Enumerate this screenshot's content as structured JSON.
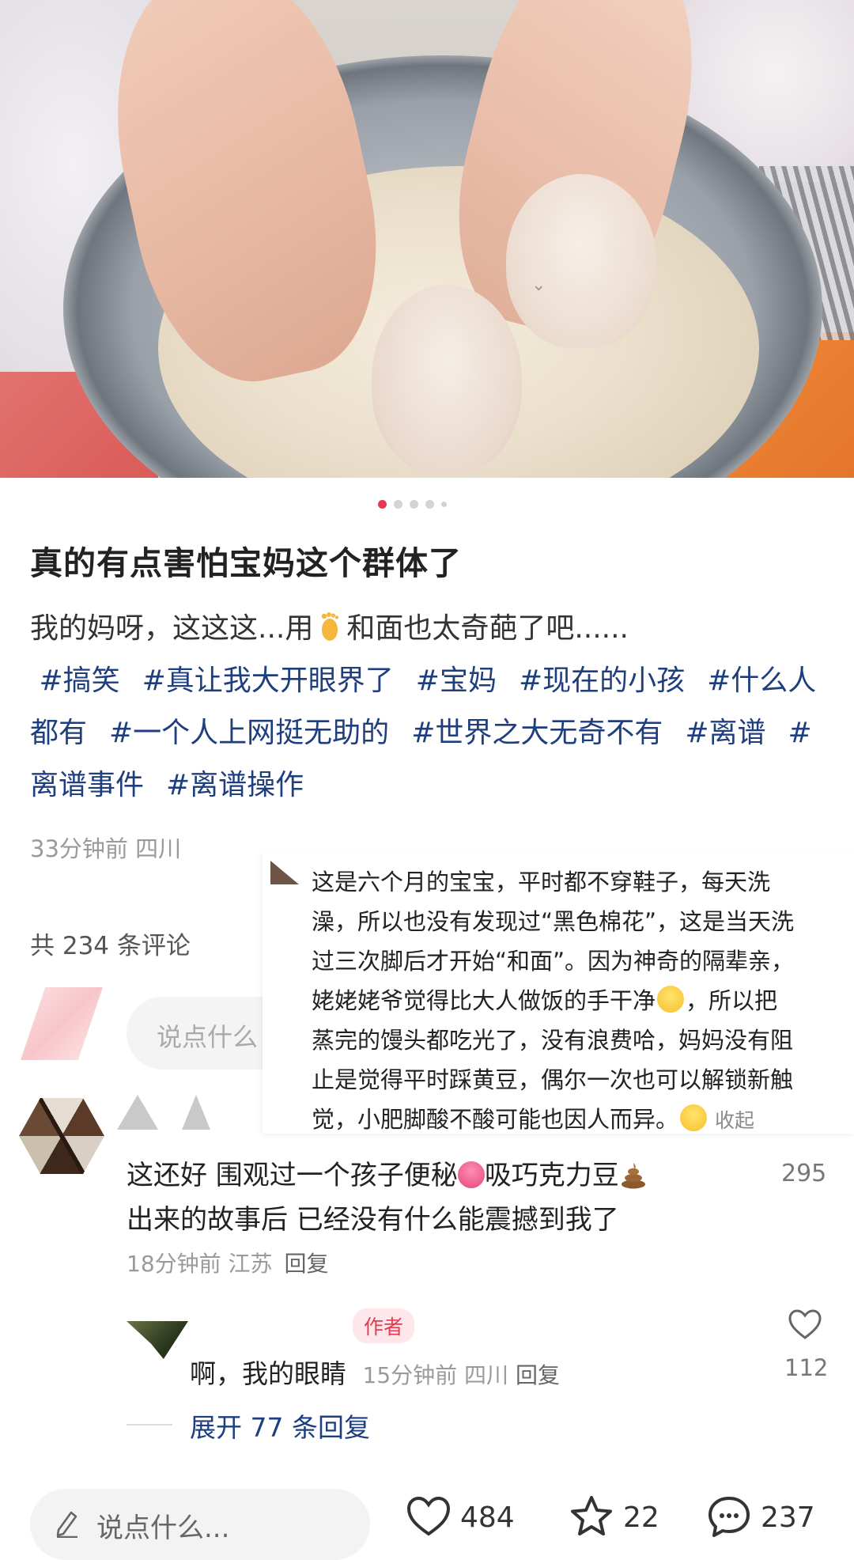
{
  "post": {
    "title": "真的有点害怕宝妈这个群体了",
    "body_before_emoji": "我的妈呀，这这这...用",
    "body_after_emoji": "和面也太奇葩了吧......",
    "tags": [
      "#搞笑",
      "#真让我大开眼界了",
      "#宝妈",
      "#现在的小孩",
      "#什么人都有",
      "#一个人上网挺无助的",
      "#世界之大无奇不有",
      "#离谱",
      "#离谱事件",
      "#离谱操作"
    ],
    "meta": "33分钟前 四川",
    "carousel": {
      "count": 5,
      "active_index": 0
    }
  },
  "comments_header": "共 234 条评论",
  "comment_input": {
    "placeholder": "说点什么"
  },
  "popup": {
    "lines": [
      "这是六个月的宝宝，平时都不穿鞋子，每天洗",
      "澡，所以也没有发现过“黑色棉花”，这是当天洗",
      "过三次脚后才开始“和面”。因为神奇的隔辈亲，",
      "姥姥姥爷觉得比大人做饭的手干净",
      "，所以把",
      "蒸完的馒头都吃光了，没有浪费哈，妈妈没有阻",
      "止是觉得平时踩黄豆，偶尔一次也可以解锁新触",
      "觉，小肥脚酸不酸可能也因人而异。",
      "收起"
    ]
  },
  "comment1": {
    "line1_a": "这还好 围观过一个孩子便秘",
    "line1_b": "吸巧克力豆",
    "line2": "出来的故事后 已经没有什么能震撼到我了",
    "time": "18分钟前",
    "location": "江苏",
    "reply": "回复",
    "likes": "295"
  },
  "author_reply": {
    "badge": "作者",
    "text": "啊，我的眼睛",
    "time": "15分钟前",
    "location": "四川",
    "reply": "回复",
    "likes": "112"
  },
  "expand_replies": "展开 77 条回复",
  "bottom_bar": {
    "input_placeholder": "说点什么...",
    "likes": "484",
    "stars": "22",
    "comments": "237"
  },
  "colors": {
    "accent": "#e8384f",
    "tag": "#1f3e7e"
  }
}
